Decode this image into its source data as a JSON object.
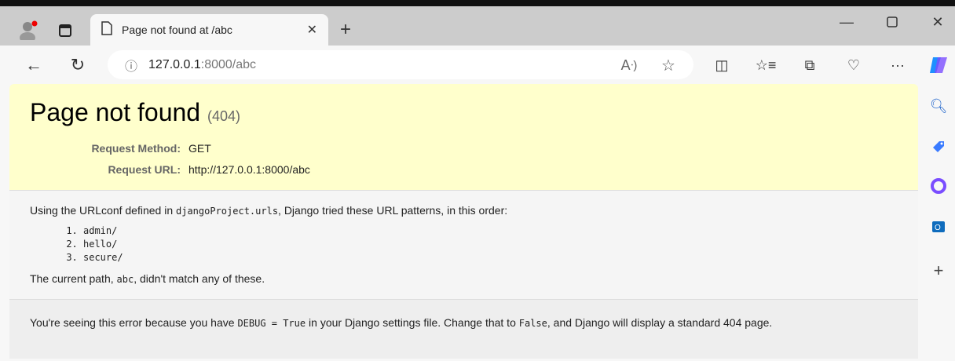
{
  "tab": {
    "title": "Page not found at /abc"
  },
  "address": {
    "host": "127.0.0.1",
    "rest": ":8000/abc"
  },
  "page": {
    "title": "Page not found",
    "code": "(404)",
    "meta": [
      {
        "key": "Request Method:",
        "value": "GET"
      },
      {
        "key": "Request URL:",
        "value": "http://127.0.0.1:8000/abc"
      }
    ],
    "info_pre": "Using the URLconf defined in ",
    "urlconf": "djangoProject.urls",
    "info_post": ", Django tried these URL patterns, in this order:",
    "patterns": [
      "admin/",
      "hello/",
      "secure/"
    ],
    "path_pre": "The current path, ",
    "path": "abc",
    "path_post": ", didn't match any of these.",
    "explain_1": "You're seeing this error because you have ",
    "debug": "DEBUG = True",
    "explain_2": " in your Django settings file. Change that to ",
    "false": "False",
    "explain_3": ", and Django will display a standard 404 page."
  },
  "colors": {
    "summary_bg": "#ffffcc",
    "accent": "#0078d4"
  }
}
